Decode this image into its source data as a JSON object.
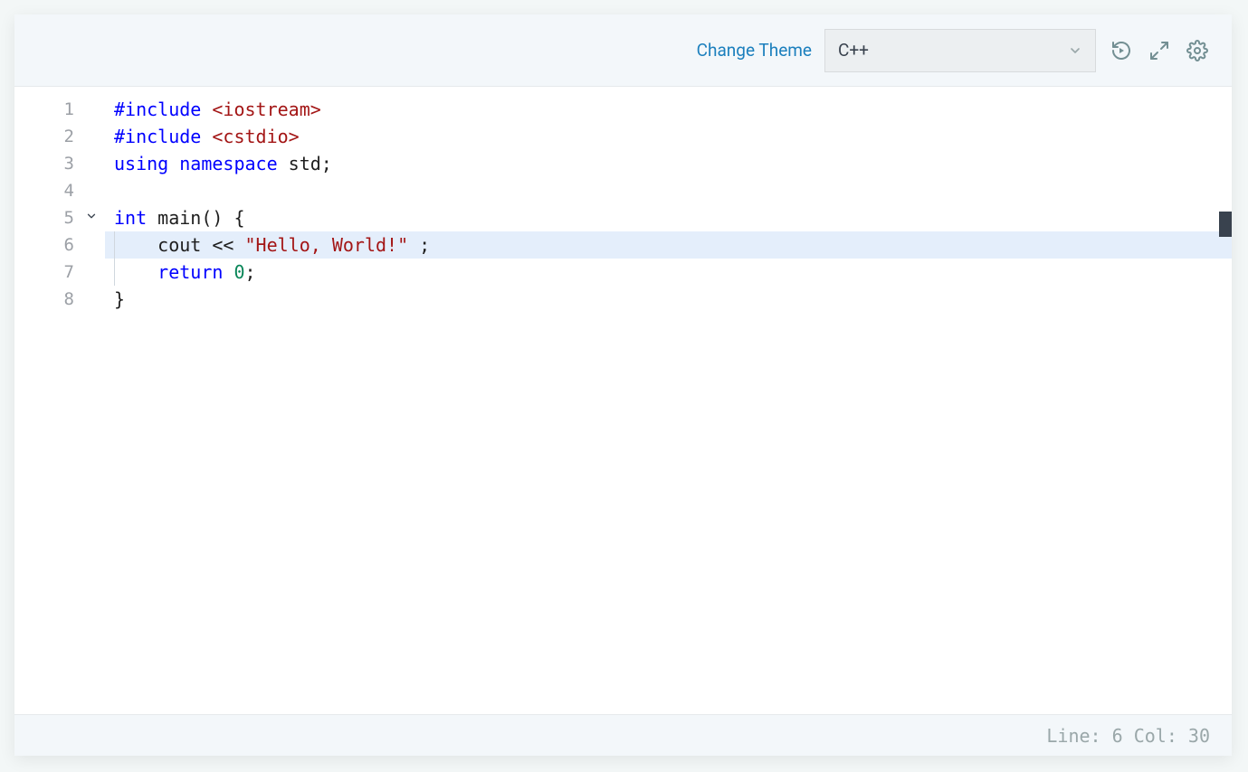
{
  "toolbar": {
    "change_theme_label": "Change Theme",
    "language_selected": "C++"
  },
  "code": {
    "lines": [
      {
        "num": "1",
        "tokens": [
          {
            "txt": "#include",
            "cls": "tok-kw"
          },
          {
            "txt": " ",
            "cls": "tok-plain"
          },
          {
            "txt": "<iostream>",
            "cls": "tok-inc"
          }
        ]
      },
      {
        "num": "2",
        "tokens": [
          {
            "txt": "#include",
            "cls": "tok-kw"
          },
          {
            "txt": " ",
            "cls": "tok-plain"
          },
          {
            "txt": "<cstdio>",
            "cls": "tok-inc"
          }
        ]
      },
      {
        "num": "3",
        "tokens": [
          {
            "txt": "using",
            "cls": "tok-kw"
          },
          {
            "txt": " ",
            "cls": "tok-plain"
          },
          {
            "txt": "namespace",
            "cls": "tok-kw"
          },
          {
            "txt": " std;",
            "cls": "tok-plain"
          }
        ]
      },
      {
        "num": "4",
        "tokens": []
      },
      {
        "num": "5",
        "fold": true,
        "tokens": [
          {
            "txt": "int",
            "cls": "tok-kw"
          },
          {
            "txt": " main() {",
            "cls": "tok-plain"
          }
        ]
      },
      {
        "num": "6",
        "highlight": true,
        "indent": true,
        "tokens": [
          {
            "txt": "    cout << ",
            "cls": "tok-plain"
          },
          {
            "txt": "\"Hello, World!\"",
            "cls": "tok-str"
          },
          {
            "txt": " ;",
            "cls": "tok-plain"
          }
        ]
      },
      {
        "num": "7",
        "indent": true,
        "tokens": [
          {
            "txt": "    ",
            "cls": "tok-plain"
          },
          {
            "txt": "return",
            "cls": "tok-kw"
          },
          {
            "txt": " ",
            "cls": "tok-plain"
          },
          {
            "txt": "0",
            "cls": "tok-num"
          },
          {
            "txt": ";",
            "cls": "tok-plain"
          }
        ]
      },
      {
        "num": "8",
        "tokens": [
          {
            "txt": "}",
            "cls": "tok-plain"
          }
        ]
      }
    ]
  },
  "status": {
    "text": "Line: 6 Col: 30"
  }
}
